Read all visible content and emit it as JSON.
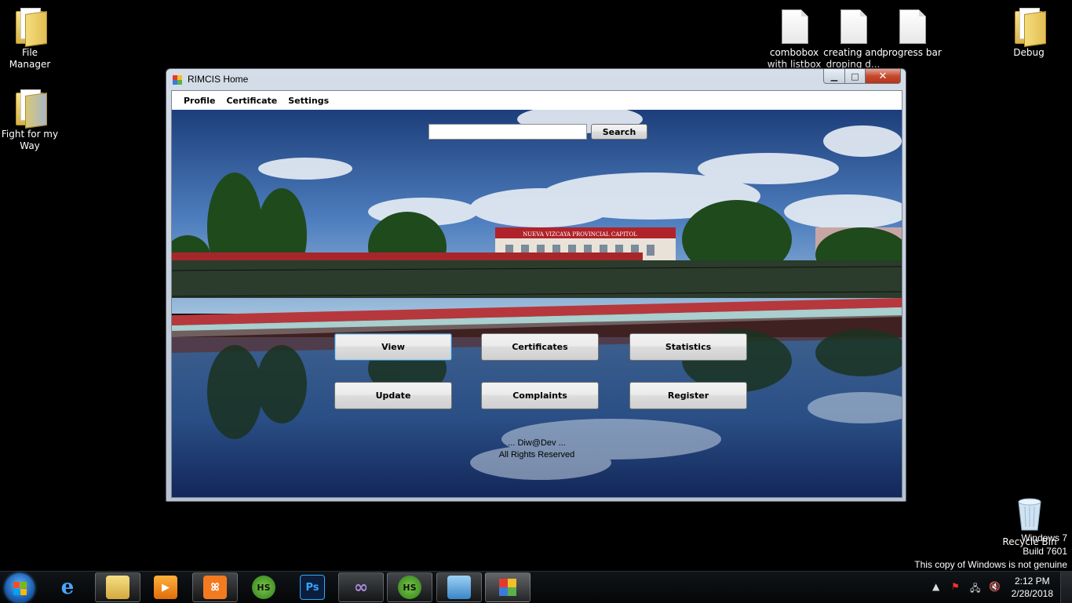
{
  "desktop": {
    "icons": [
      {
        "label": "File Manager"
      },
      {
        "label": "Fight for my Way"
      },
      {
        "label": "combobox with listbox"
      },
      {
        "label": "creating and droping d..."
      },
      {
        "label": "progress bar"
      },
      {
        "label": "Debug"
      },
      {
        "label": "Recycle Bin"
      }
    ],
    "watermark": {
      "line1": "Windows 7",
      "line2": "Build 7601",
      "line3": "This copy of Windows is not genuine"
    }
  },
  "window": {
    "title": "RIMCIS Home",
    "controls": {
      "minimize": "▁",
      "maximize": "□",
      "close": "✕"
    },
    "menu": [
      "Profile",
      "Certificate",
      "Settings"
    ],
    "search": {
      "value": "",
      "button_label": "Search"
    },
    "buttons": {
      "view": "View",
      "certificates": "Certificates",
      "statistics": "Statistics",
      "update": "Update",
      "complaints": "Complaints",
      "register": "Register"
    },
    "footer": {
      "line1": "... Diw@Dev ...",
      "line2": "All Rights Reserved"
    },
    "banner_text": "NUEVA VIZCAYA PROVINCIAL CAPITOL"
  },
  "taskbar": {
    "apps": [
      {
        "icon": "internet-explorer-icon"
      },
      {
        "icon": "file-explorer-icon"
      },
      {
        "icon": "media-player-icon"
      },
      {
        "icon": "xampp-icon"
      },
      {
        "icon": "hs-icon",
        "label": "HS"
      },
      {
        "icon": "photoshop-icon",
        "label": "Ps"
      },
      {
        "icon": "visual-studio-icon"
      },
      {
        "icon": "hs-icon",
        "label": "HS"
      },
      {
        "icon": "remote-desktop-icon"
      },
      {
        "icon": "rimcis-app-icon"
      }
    ],
    "clock": {
      "time": "2:12 PM",
      "date": "2/28/2018"
    },
    "tray": {
      "show_hidden": "▲"
    }
  }
}
